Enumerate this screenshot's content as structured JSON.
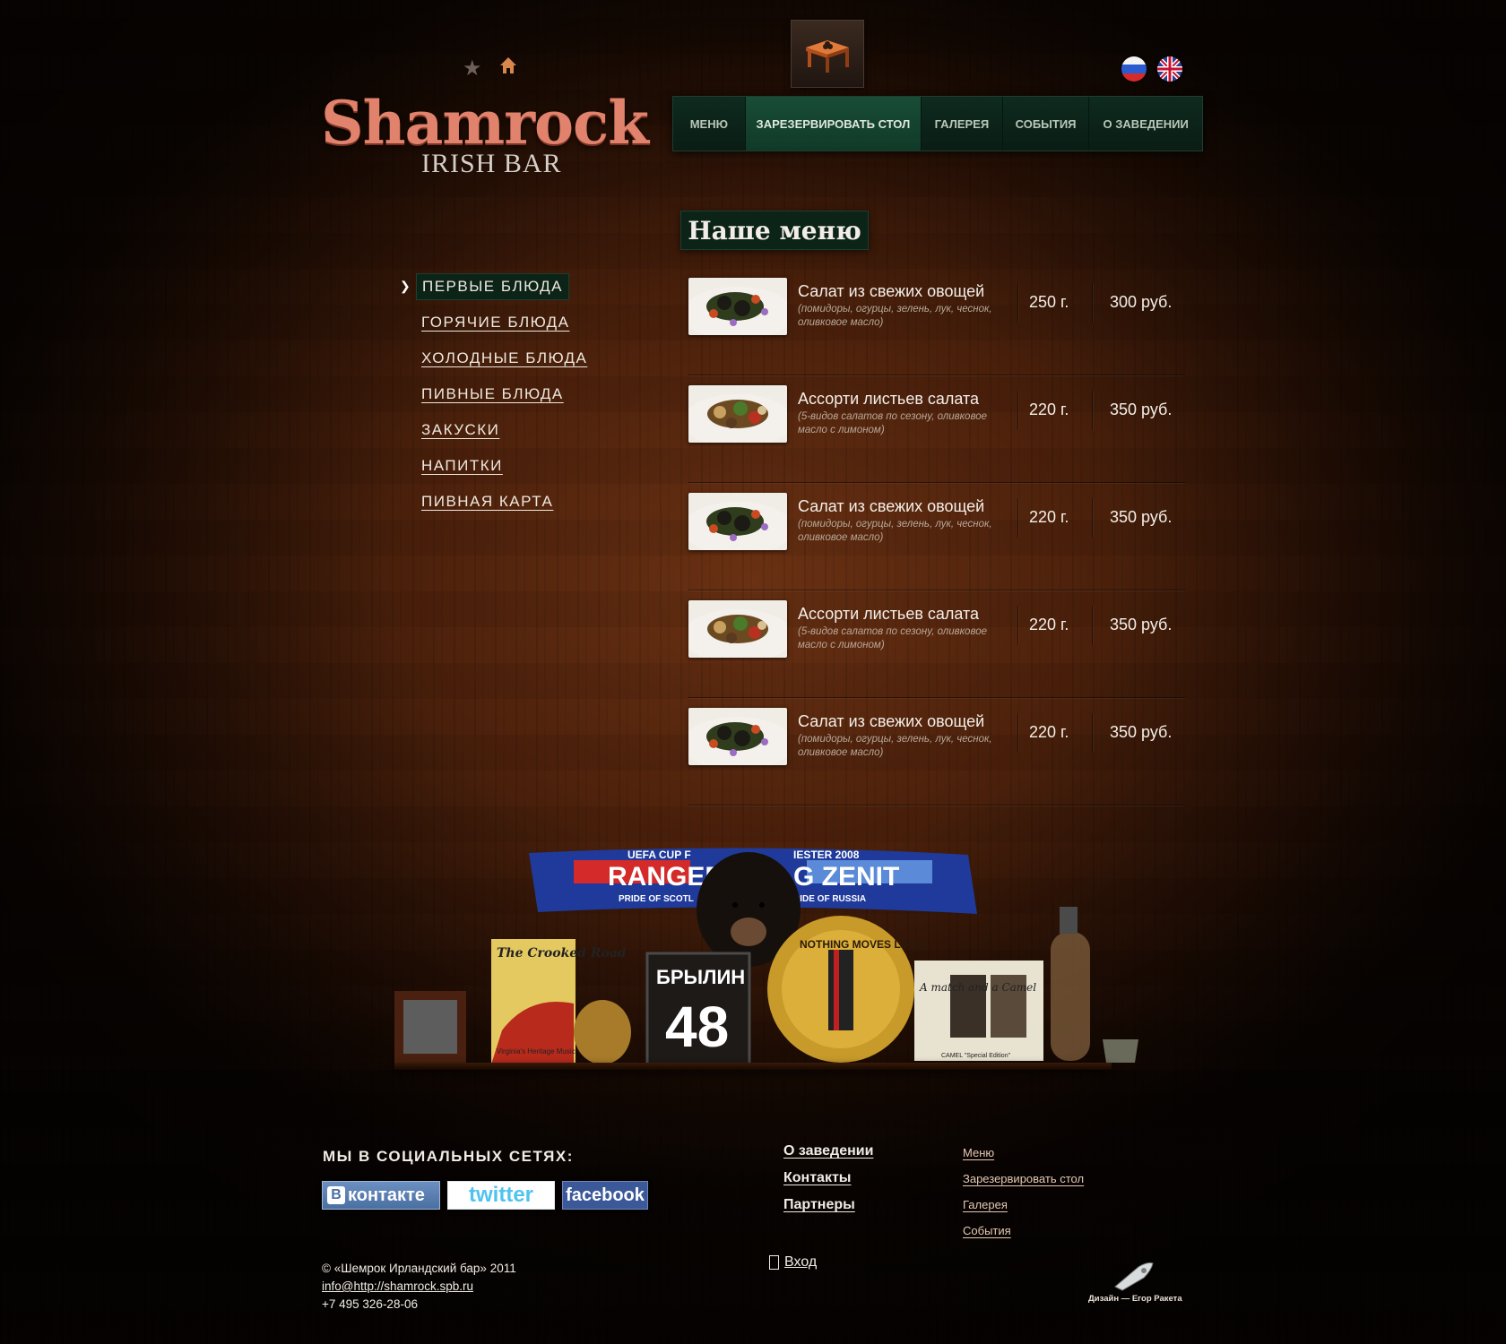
{
  "header": {
    "logo_title": "Shamrock",
    "logo_sub": "IRISH BAR",
    "nav": [
      "МЕНЮ",
      "ЗАРЕЗЕРВИРОВАТЬ СТОЛ",
      "ГАЛЕРЕЯ",
      "СОБЫТИЯ",
      "О ЗАВЕДЕНИИ"
    ],
    "nav_active": 1
  },
  "page_title": "Наше меню",
  "sidebar": {
    "items": [
      "ПЕРВЫЕ БЛЮДА",
      "ГОРЯЧИЕ БЛЮДА",
      "ХОЛОДНЫЕ БЛЮДА",
      "ПИВНЫЕ БЛЮДА",
      "ЗАКУСКИ",
      "НАПИТКИ",
      "ПИВНАЯ КАРТА"
    ],
    "active": 0
  },
  "menu_items": [
    {
      "name": "Салат из свежих овощей",
      "desc": "(помидоры, огурцы, зелень, лук, чеснок, оливковое масло)",
      "weight": "250 г.",
      "price": "300 руб."
    },
    {
      "name": "Ассорти листьев салата",
      "desc": "(5-видов салатов по сезону, оливковое масло с лимоном)",
      "weight": "220 г.",
      "price": "350 руб."
    },
    {
      "name": "Салат из свежих овощей",
      "desc": "(помидоры, огурцы, зелень, лук, чеснок, оливковое масло)",
      "weight": "220 г.",
      "price": "350 руб."
    },
    {
      "name": "Ассорти листьев салата",
      "desc": "(5-видов салатов по сезону, оливковое масло с лимоном)",
      "weight": "220 г.",
      "price": "350 руб."
    },
    {
      "name": "Салат из свежих овощей",
      "desc": "(помидоры, огурцы, зелень, лук, чеснок, оливковое масло)",
      "weight": "220 г.",
      "price": "350 руб."
    }
  ],
  "footer": {
    "social_title": "МЫ В СОЦИАЛЬНЫХ СЕТЯХ:",
    "social": {
      "vk": "контакте",
      "twitter": "twitter",
      "facebook": "facebook"
    },
    "copyright": "© «Шемрок Ирландский бар» 2011",
    "email": "info@http://shamrock.spb.ru",
    "phone": "+7 495 326-28-06",
    "mid_links": [
      "О заведении",
      "Контакты",
      "Партнеры"
    ],
    "right_links": [
      "Меню",
      "Зарезервировать стол",
      "Галерея",
      "События"
    ],
    "login": "Вход",
    "designer": "Дизайн — Егор Ракета"
  },
  "shelf_items": {
    "scarf_top_left": "UEFA CUP F",
    "scarf_left": "RANGER",
    "scarf_left_sub": "PRIDE OF SCOTL",
    "scarf_top_right": "IESTER 2008",
    "scarf_right": "G ZENIT",
    "scarf_right_sub": "RIDE OF RUSSIA",
    "sign_title": "The Crooked Road",
    "sign_sub": "Virginia's Heritage Music Trail",
    "jersey_name": "БРЫЛИН",
    "jersey_number": "48",
    "medal_text": "NOTHING MOVES LIKE A",
    "poster_text": "A match and a Camel",
    "poster_footer": "CAMEL \"Special Edition\""
  },
  "colors": {
    "accent": "#e0826c",
    "nav_bg": "#0e2a1f",
    "nav_active": "#184d36",
    "wood": "#4a200b"
  }
}
